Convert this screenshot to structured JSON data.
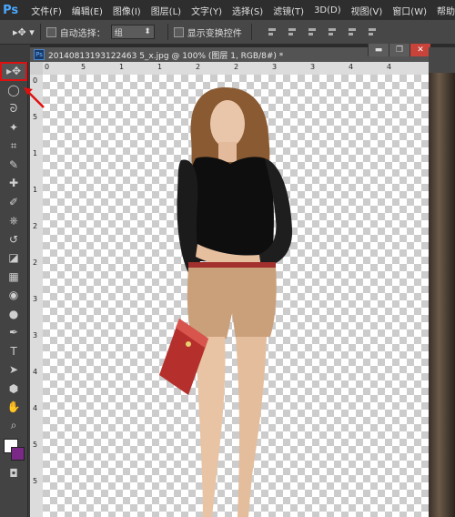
{
  "app": {
    "logo": "Ps"
  },
  "menu": [
    "文件(F)",
    "编辑(E)",
    "图像(I)",
    "图层(L)",
    "文字(Y)",
    "选择(S)",
    "滤镜(T)",
    "3D(D)",
    "视图(V)",
    "窗口(W)",
    "帮助"
  ],
  "options": {
    "auto_select_label": "自动选择：",
    "auto_select_value": "组",
    "show_transform_label": "显示变换控件"
  },
  "document": {
    "tab_title": "20140813193122463 5_x.jpg @ 100% (图层 1, RGB/8#) *",
    "ps_badge": "Ps"
  },
  "window_buttons": {
    "minimize": "▬",
    "restore": "❐",
    "close": "✕"
  },
  "rulers": {
    "h": [
      "0",
      "5",
      "1",
      "1",
      "2",
      "2",
      "3",
      "3",
      "4",
      "4"
    ],
    "v": [
      "0",
      "5",
      "1",
      "1",
      "2",
      "2",
      "3",
      "3",
      "4",
      "4",
      "5",
      "5"
    ]
  },
  "colors": {
    "foreground": "#ffffff",
    "background": "#7a2a86",
    "highlight": "#e01010"
  },
  "tools": [
    "move-tool",
    "lasso-marquee-tool",
    "lasso-tool",
    "magic-wand-tool",
    "crop-tool",
    "eyedropper-tool",
    "healing-brush-tool",
    "brush-tool",
    "clone-stamp-tool",
    "history-brush-tool",
    "eraser-tool",
    "gradient-tool",
    "blur-tool",
    "dodge-tool",
    "pen-tool",
    "type-tool",
    "path-selection-tool",
    "shape-tool",
    "hand-tool",
    "zoom-tool"
  ],
  "tool_glyphs": [
    "▸✥",
    "◯",
    "ᘐ",
    "✦",
    "⌗",
    "✎",
    "✚",
    "✐",
    "⎈",
    "↺",
    "◪",
    "▦",
    "◉",
    "●",
    "✒",
    "T",
    "➤",
    "⬢",
    "✋",
    "⌕"
  ]
}
